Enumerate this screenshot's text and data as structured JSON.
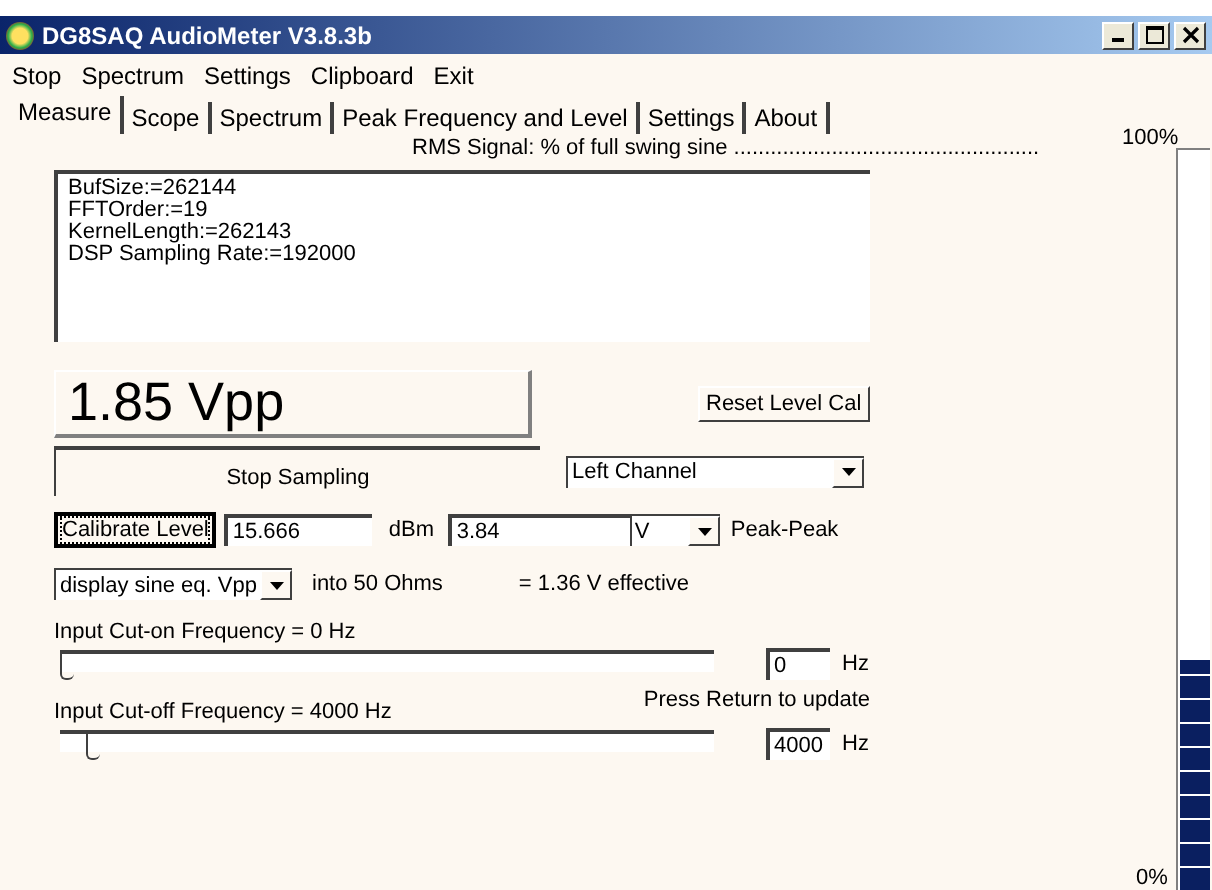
{
  "window": {
    "title": "DG8SAQ AudioMeter V3.8.3b"
  },
  "menu": [
    "Stop",
    "Spectrum",
    "Settings",
    "Clipboard",
    "Exit"
  ],
  "tabs": [
    {
      "label": "Measure",
      "selected": true
    },
    {
      "label": "Scope",
      "selected": false
    },
    {
      "label": "Spectrum",
      "selected": false
    },
    {
      "label": "Peak Frequency and Level",
      "selected": false
    },
    {
      "label": "Settings",
      "selected": false
    },
    {
      "label": "About",
      "selected": false
    }
  ],
  "rms_caption": "RMS Signal: % of full swing sine ..................................................",
  "info_lines": [
    "BufSize:=262144",
    "FFTOrder:=19",
    "KernelLength:=262143",
    "DSP Sampling Rate:=192000"
  ],
  "readout": "1.85 Vpp",
  "reset_button": "Reset Level Cal",
  "stop_button": "Stop Sampling",
  "channel": "Left Channel",
  "calibrate_button": "Calibrate Level",
  "dbm_value": "15.666",
  "dbm_unit": "dBm",
  "volt_value": "3.84",
  "volt_unit": "V",
  "peak_label": "Peak-Peak",
  "display_mode": "display sine eq. Vpp",
  "load_label": "into 50 Ohms",
  "effective_label": "= 1.36 V effective",
  "cut_on": {
    "label": "Input Cut-on Frequency = 0 Hz",
    "level": 0,
    "value": "0",
    "unit": "Hz"
  },
  "return_hint": "Press Return to update",
  "cut_off": {
    "label": "Input Cut-off Frequency = 4000 Hz",
    "level": 0.04,
    "value": "4000",
    "unit": "Hz"
  },
  "meter": {
    "top_label": "100%",
    "bottom_label": "0%",
    "level": 0.31
  }
}
